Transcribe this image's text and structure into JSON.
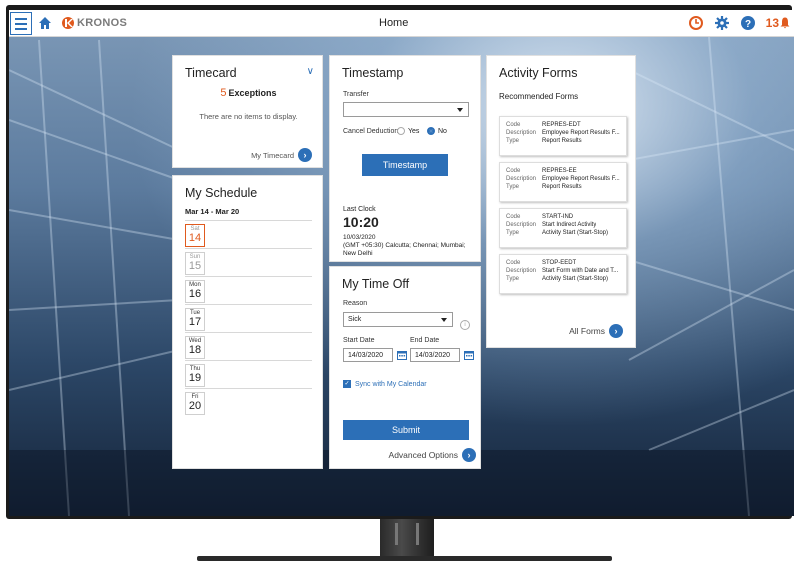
{
  "topbar": {
    "logo_text": "KRONOS",
    "title": "Home",
    "notification_count": "13"
  },
  "timecard": {
    "title": "Timecard",
    "exceptions_count": "5",
    "exceptions_label": "Exceptions",
    "empty_text": "There are no items to display.",
    "link_label": "My Timecard"
  },
  "schedule": {
    "title": "My Schedule",
    "range": "Mar 14 - Mar 20",
    "days": [
      {
        "name": "Sat",
        "date": "14"
      },
      {
        "name": "Sun",
        "date": "15"
      },
      {
        "name": "Mon",
        "date": "16"
      },
      {
        "name": "Tue",
        "date": "17"
      },
      {
        "name": "Wed",
        "date": "18"
      },
      {
        "name": "Thu",
        "date": "19"
      },
      {
        "name": "Fri",
        "date": "20"
      }
    ]
  },
  "timestamp": {
    "title": "Timestamp",
    "transfer_label": "Transfer",
    "transfer_value": "",
    "cancel_deduction_label": "Cancel Deduction?",
    "yes_label": "Yes",
    "no_label": "No",
    "selected": "No",
    "button_label": "Timestamp",
    "last_clock_label": "Last Clock",
    "last_clock_time": "10:20",
    "last_clock_date": "10/03/2020",
    "last_clock_zone": "(GMT +05:30) Calcutta; Chennai; Mumbai; New Delhi"
  },
  "time_off": {
    "title": "My Time Off",
    "reason_label": "Reason",
    "reason_value": "Sick",
    "start_label": "Start Date",
    "start_value": "14/03/2020",
    "end_label": "End Date",
    "end_value": "14/03/2020",
    "sync_label": "Sync with My Calendar",
    "submit_label": "Submit",
    "advanced_label": "Advanced Options"
  },
  "activity_forms": {
    "title": "Activity Forms",
    "subtitle": "Recommended Forms",
    "key_code": "Code",
    "key_description": "Description",
    "key_type": "Type",
    "forms": [
      {
        "code": "REPRES-EDT",
        "description": "Employee Report Results F...",
        "type": "Report Results"
      },
      {
        "code": "REPRES-EE",
        "description": "Employee Report Results F...",
        "type": "Report Results"
      },
      {
        "code": "START-IND",
        "description": "Start Indirect Activity",
        "type": "Activity Start (Start-Stop)"
      },
      {
        "code": "STOP-EEDT",
        "description": "Start Form with Date and T...",
        "type": "Activity Start (Start-Stop)"
      }
    ],
    "all_label": "All Forms"
  },
  "colors": {
    "accent": "#2c6fb7",
    "alert": "#e05a1e"
  }
}
